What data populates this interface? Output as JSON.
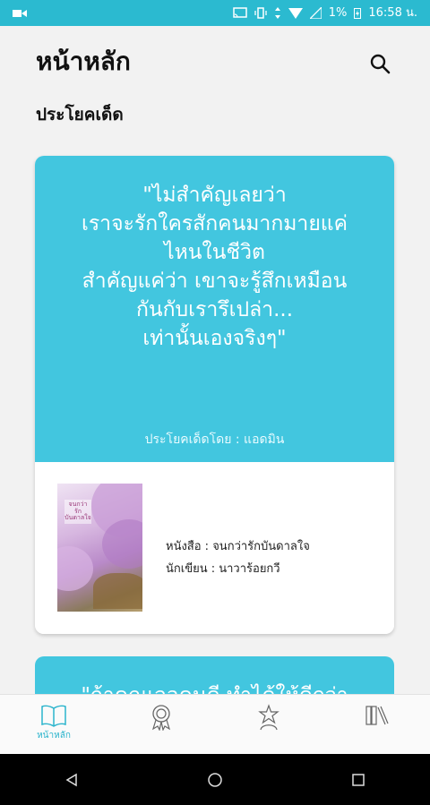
{
  "status_bar": {
    "battery": "1%",
    "time": "16:58 น."
  },
  "header": {
    "title": "หน้าหลัก",
    "search_icon": "search-icon"
  },
  "section": {
    "title": "ประโยคเด็ด"
  },
  "quote_card": {
    "lines": [
      "\"ไม่สำคัญเลยว่า",
      "เราจะรักใครสักคนมากมายแค่",
      "ไหนในชีวิต",
      "สำคัญแค่ว่า เขาจะรู้สึกเหมือน",
      "กันกับเรารึเปล่า...",
      "เท่านั้นเองจริงๆ\""
    ],
    "author": "ประโยคเด็ดโดย : แอดมิน",
    "book_label": "หนังสือ : จนกว่ารักบันดาลใจ",
    "writer_label": "นักเขียน : นาวาร้อยกวี",
    "cover_text": "จนกว่า รัก บันดาลใจ"
  },
  "next_card": {
    "partial_text": "\"ถ้าคุณเจอคนดี ทำได้ให้ดีกว่า"
  },
  "bottom_nav": {
    "items": [
      {
        "name": "home",
        "label": "หน้าหลัก",
        "icon": "book-open-icon",
        "active": true
      },
      {
        "name": "awards",
        "label": "",
        "icon": "award-badge-icon",
        "active": false
      },
      {
        "name": "writers",
        "label": "",
        "icon": "star-person-icon",
        "active": false
      },
      {
        "name": "library",
        "label": "",
        "icon": "bookshelf-icon",
        "active": false
      }
    ]
  },
  "colors": {
    "accent": "#2bbad0",
    "card": "#42c6df"
  }
}
